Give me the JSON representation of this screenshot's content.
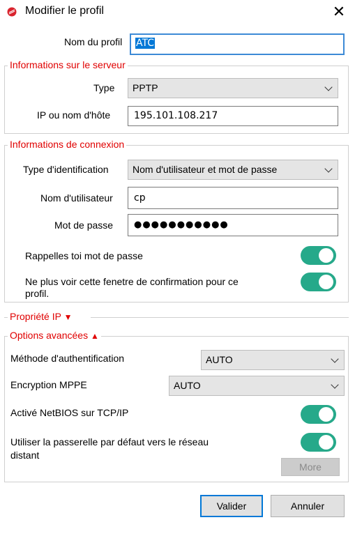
{
  "window": {
    "title": "Modifier le profil",
    "close_glyph": "✕"
  },
  "profile": {
    "label": "Nom du profil",
    "value": "ATC"
  },
  "server": {
    "legend": "Informations sur le serveur",
    "type_label": "Type",
    "type_value": "PPTP",
    "host_label": "IP ou nom d'hôte",
    "host_value": "195.101.108.217"
  },
  "connection": {
    "legend": "Informations de connexion",
    "auth_type_label": "Type d'identification",
    "auth_type_value": "Nom d'utilisateur et mot de passe",
    "username_label": "Nom d'utilisateur",
    "username_value": "cp",
    "password_label": "Mot de passe",
    "password_value": "●●●●●●●●●●●",
    "remember_label": "Rappelles toi mot de passe",
    "remember_on": true,
    "hide_confirm_label_line1": "Ne plus voir cette fenetre de confirmation pour ce",
    "hide_confirm_label_line2": "profil.",
    "hide_confirm_on": true
  },
  "ip_props": {
    "label": "Propriété IP",
    "arrow": "▼"
  },
  "advanced": {
    "legend": "Options avancées",
    "arrow": "▲",
    "auth_method_label": "Méthode d'authentification",
    "auth_method_value": "AUTO",
    "mppe_label": "Encryption MPPE",
    "mppe_value": "AUTO",
    "netbios_label": "Activé NetBIOS sur TCP/IP",
    "netbios_on": true,
    "gateway_label_line1": "Utiliser la passerelle par défaut vers le réseau",
    "gateway_label_line2": "distant",
    "gateway_on": true,
    "more_label": "More"
  },
  "buttons": {
    "ok": "Valider",
    "cancel": "Annuler"
  },
  "colors": {
    "accent": "#0078d7",
    "legend_red": "#e00000",
    "toggle_on": "#26a98a"
  }
}
